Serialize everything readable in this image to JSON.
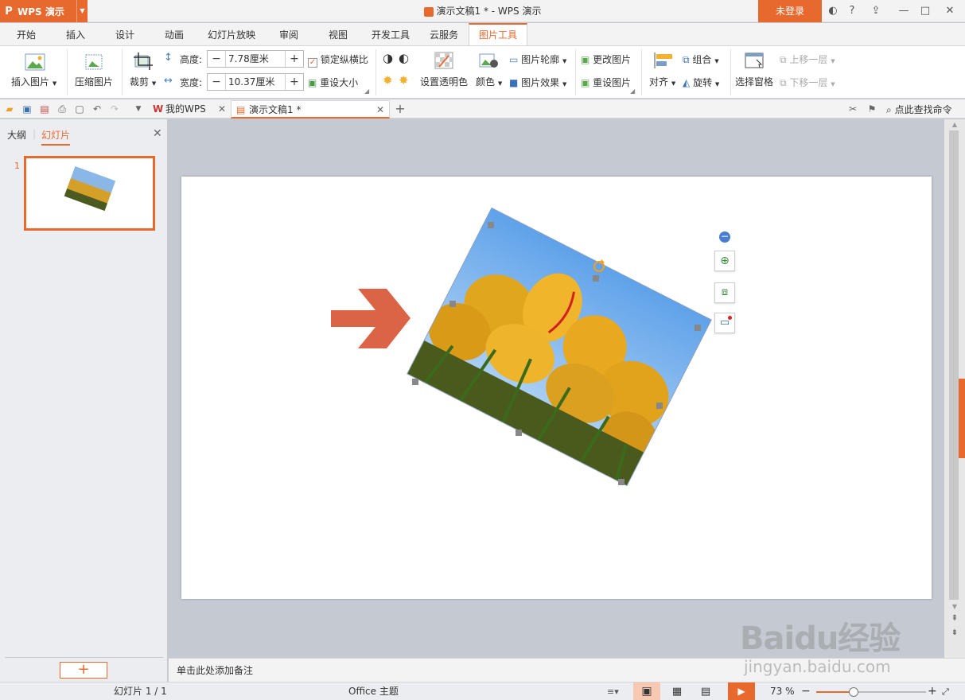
{
  "titlebar": {
    "app_name": "WPS 演示",
    "window_title": "演示文稿1 * - WPS 演示",
    "login_label": "未登录"
  },
  "ribbon_tabs": [
    "开始",
    "插入",
    "设计",
    "动画",
    "幻灯片放映",
    "审阅",
    "视图",
    "开发工具",
    "云服务",
    "图片工具"
  ],
  "active_tab": "图片工具",
  "ribbon": {
    "insert_picture": "插入图片",
    "compress_picture": "压缩图片",
    "crop": "裁剪",
    "height_label": "高度:",
    "height_value": "7.78厘米",
    "width_label": "宽度:",
    "width_value": "10.37厘米",
    "lock_ratio": "锁定纵横比",
    "reset_size": "重设大小",
    "set_transparent": "设置透明色",
    "color": "颜色",
    "picture_outline": "图片轮廓",
    "picture_effects": "图片效果",
    "change_picture": "更改图片",
    "reset_picture": "重设图片",
    "align": "对齐",
    "group": "组合",
    "rotate": "旋转",
    "selection_pane": "选择窗格",
    "bring_forward": "上移一层",
    "send_backward": "下移一层"
  },
  "doc_tabs": {
    "my_wps": "我的WPS",
    "document": "演示文稿1 *"
  },
  "search_command": "点此查找命令",
  "left_panel": {
    "outline_tab": "大纲",
    "slides_tab": "幻灯片",
    "slide_number": "1",
    "add_label": "+"
  },
  "notes_placeholder": "单击此处添加备注",
  "status": {
    "slide_info": "幻灯片 1 / 1",
    "theme": "Office 主题",
    "zoom": "73 %"
  },
  "watermark": {
    "brand": "Baidu经验",
    "url": "jingyan.baidu.com"
  },
  "colors": {
    "accent": "#e8692e",
    "arrow": "#dc6446"
  }
}
